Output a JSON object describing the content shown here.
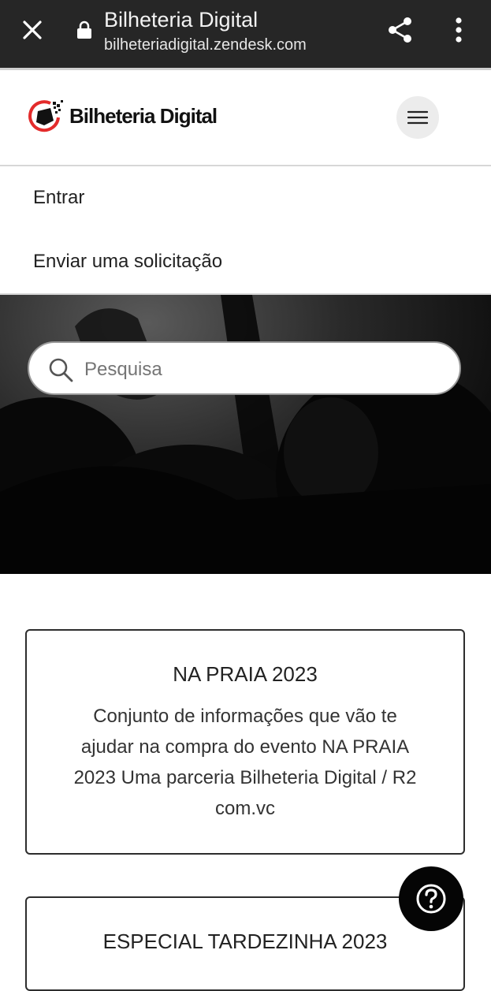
{
  "browser": {
    "title": "Bilheteria Digital",
    "url": "bilheteriadigital.zendesk.com",
    "icons": [
      "close-icon",
      "lock-icon",
      "share-icon",
      "more-vertical-icon"
    ]
  },
  "header": {
    "brand_name": "Bilheteria Digital",
    "menu_icon": "hamburger-icon",
    "brand_color": "#e32b2b"
  },
  "menu": {
    "items": [
      {
        "label": "Entrar"
      },
      {
        "label": "Enviar uma solicitação"
      }
    ]
  },
  "search": {
    "placeholder": "Pesquisa",
    "icon": "search-icon"
  },
  "categories": [
    {
      "title": "NA PRAIA 2023",
      "description": "Conjunto de informações que vão te ajudar na compra do evento NA PRAIA 2023 Uma parceria Bilheteria Digital / R2 com.vc"
    },
    {
      "title": "ESPECIAL TARDEZINHA 2023",
      "description": ""
    }
  ],
  "help": {
    "icon": "help-question-icon"
  }
}
